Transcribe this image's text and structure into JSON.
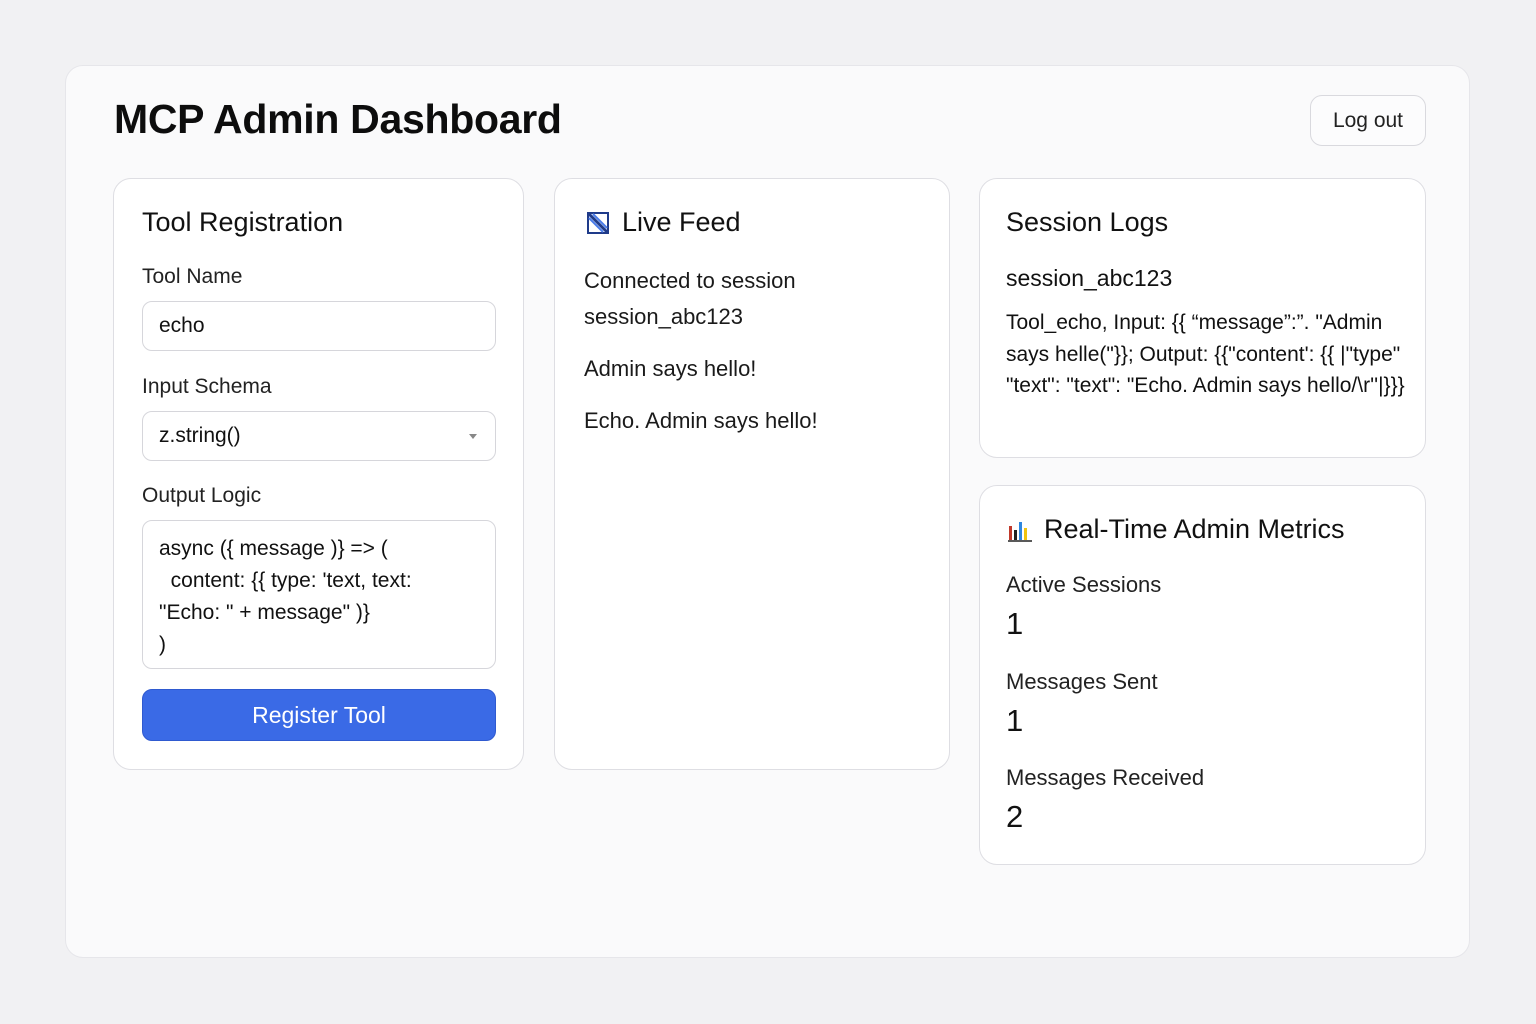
{
  "header": {
    "title": "MCP Admin Dashboard",
    "logout_label": "Log out"
  },
  "tool_registration": {
    "title": "Tool Registration",
    "tool_name_label": "Tool Name",
    "tool_name_value": "echo",
    "input_schema_label": "Input Schema",
    "input_schema_value": "z.string()",
    "output_logic_label": "Output Logic",
    "output_logic_value": "async ({ message )} => (\n  content: {{ type: 'text, text:\n\"Echo: \" + message\" )}\n)",
    "submit_label": "Register Tool"
  },
  "live_feed": {
    "title": "Live Feed",
    "icon": "feed-icon",
    "messages": [
      "Connected to session session_abc123",
      "Admin says hello!",
      "Echo. Admin says hello!"
    ]
  },
  "session_logs": {
    "title": "Session Logs",
    "session_id": "session_abc123",
    "entry": "Tool_echo, Input: {{ “message”:”. \"Admin says helle(\"}}; Output: {{\"content': {{ |\"type\" \"text\": \"text\": \"Echo. Admin says hello/\\r''|}}}"
  },
  "metrics": {
    "title": "Real-Time Admin Metrics",
    "icon": "bar-chart-icon",
    "items": [
      {
        "label": "Active Sessions",
        "value": "1"
      },
      {
        "label": "Messages Sent",
        "value": "1"
      },
      {
        "label": "Messages Received",
        "value": "2"
      }
    ]
  },
  "colors": {
    "primary": "#3a6ae6",
    "background": "#f1f1f3",
    "card": "#ffffff",
    "border": "#dedee3"
  }
}
